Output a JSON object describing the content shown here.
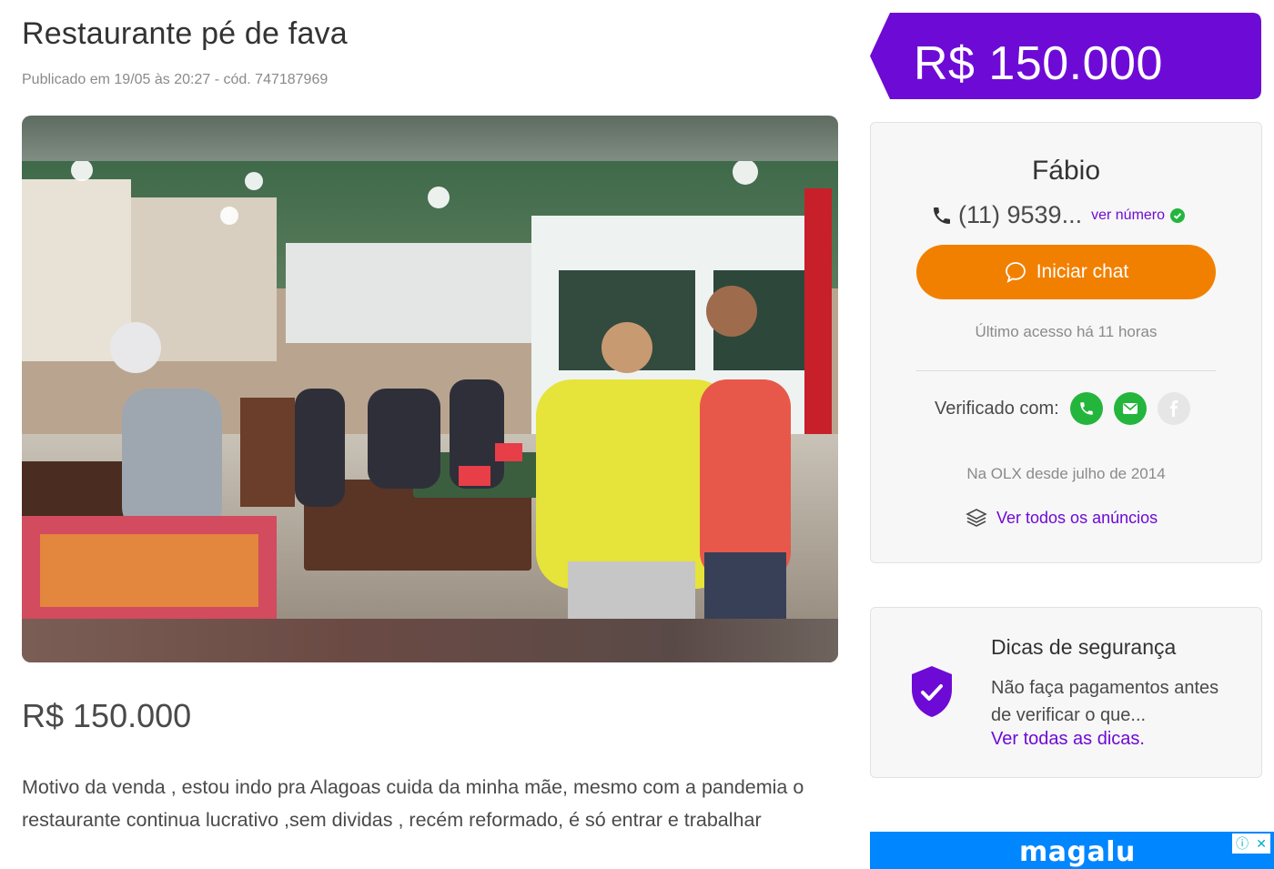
{
  "listing": {
    "title": "Restaurante pé de fava",
    "published": "Publicado em 19/05 às 20:27 - cód. 747187969",
    "price": "R$ 150.000",
    "description": "Motivo da venda , estou indo pra Alagoas cuida da minha mãe, mesmo com a pandemia o restaurante continua lucrativo ,sem dividas , recém reformado, é só entrar e trabalhar"
  },
  "price_tag": {
    "text": "R$ 150.000",
    "color": "#6e0ad6"
  },
  "seller": {
    "name": "Fábio",
    "phone": "(11) 9539...",
    "see_number": "ver número",
    "chat_label": "Iniciar chat",
    "last_access": "Último acesso há 11 horas",
    "verified_label": "Verificado com:",
    "verified_icons": [
      "phone-icon",
      "email-icon",
      "facebook-icon"
    ],
    "since": "Na OLX desde julho de 2014",
    "all_ads": "Ver todos os anúncios"
  },
  "safety": {
    "title": "Dicas de segurança",
    "text": "Não faça pagamentos antes de verificar o que...",
    "link": "Ver todas as dicas."
  },
  "ad": {
    "brand": "magalu"
  },
  "colors": {
    "accent": "#6e0ad6",
    "orange": "#f28000",
    "green": "#24b53d",
    "ad_blue": "#0086ff"
  }
}
